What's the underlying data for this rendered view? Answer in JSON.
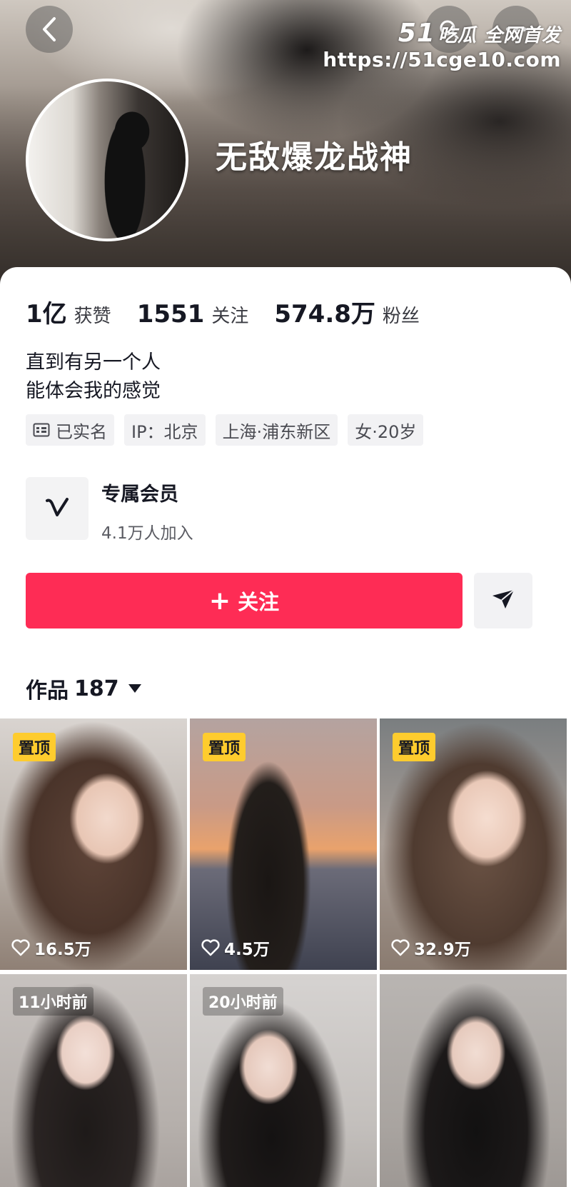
{
  "watermark": {
    "brand_num": "51",
    "brand_text": "吃瓜 全网首发",
    "url": "https://51cge10.com"
  },
  "profile": {
    "nickname": "无敌爆龙战神"
  },
  "stats": [
    {
      "value": "1亿",
      "label": "获赞"
    },
    {
      "value": "1551",
      "label": "关注"
    },
    {
      "value": "574.8万",
      "label": "粉丝"
    }
  ],
  "bio": {
    "line1": "直到有另一个人",
    "line2": "能体会我的感觉"
  },
  "tags": [
    {
      "label": "已实名",
      "icon": "id-card-icon"
    },
    {
      "label": "IP：北京"
    },
    {
      "label": "上海·浦东新区"
    },
    {
      "label": "女·20岁"
    }
  ],
  "member": {
    "title": "专属会员",
    "subtitle": "4.1万人加入",
    "icon": "v-logo-icon"
  },
  "actions": {
    "follow_plus": "+",
    "follow_label": "关注",
    "share_icon": "share-arrow-icon"
  },
  "works": {
    "label": "作品",
    "count": "187"
  },
  "videos": [
    {
      "badge": "置顶",
      "likes": "16.5万"
    },
    {
      "badge": "置顶",
      "likes": "4.5万"
    },
    {
      "badge": "置顶",
      "likes": "32.9万"
    },
    {
      "time": "11小时前"
    },
    {
      "time": "20小时前"
    },
    {}
  ],
  "colors": {
    "accent": "#fe2c55",
    "pin_badge": "#fecc2e",
    "tag_bg": "#f2f2f4"
  }
}
